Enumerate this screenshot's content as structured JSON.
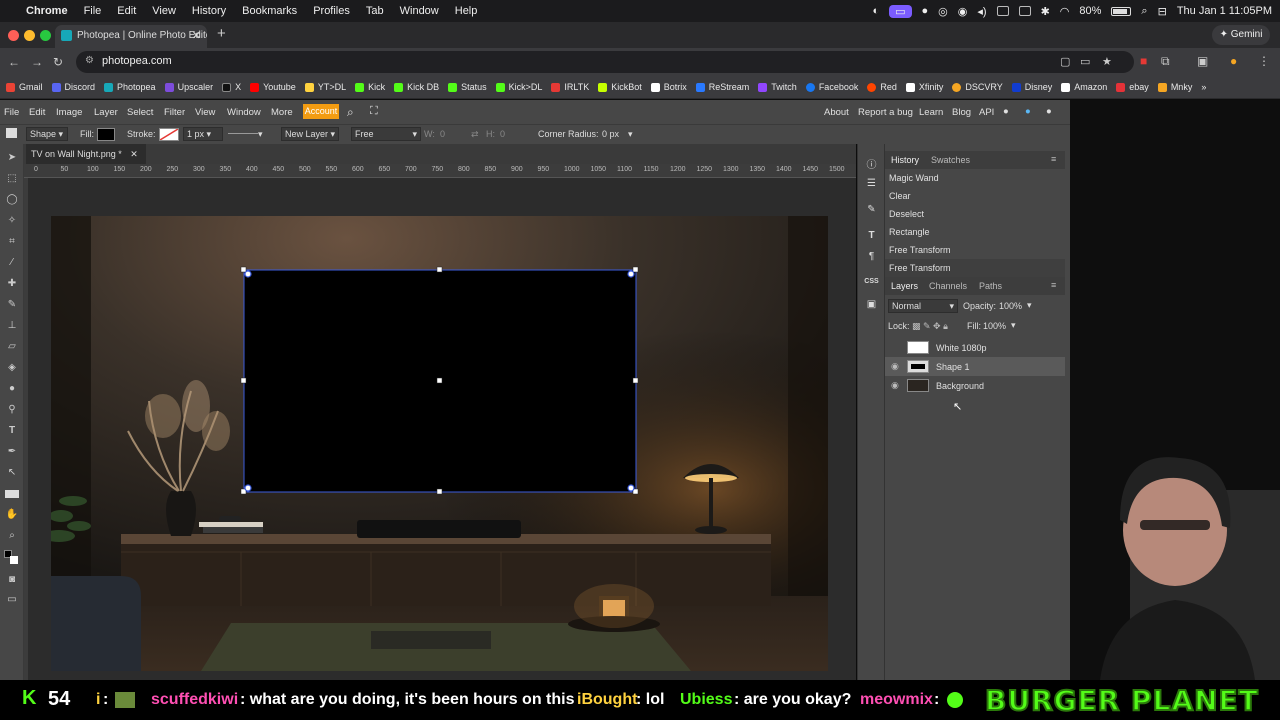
{
  "mac_menubar": {
    "app": "Chrome",
    "items": [
      "File",
      "Edit",
      "View",
      "History",
      "Bookmarks",
      "Profiles",
      "Tab",
      "Window",
      "Help"
    ],
    "battery": "80%",
    "datetime": "Thu Jan 1  11:05PM"
  },
  "browser": {
    "tab_title": "Photopea | Online Photo Edito",
    "url": "photopea.com",
    "gemini": "Gemini",
    "bookmarks": [
      {
        "label": "Gmail",
        "color": "#ea4335"
      },
      {
        "label": "Discord",
        "color": "#5865f2"
      },
      {
        "label": "Photopea",
        "color": "#17a8b8"
      },
      {
        "label": "Upscaler",
        "color": "#7d4cdb"
      },
      {
        "label": "X",
        "color": "#000000"
      },
      {
        "label": "Youtube",
        "color": "#ff0000"
      },
      {
        "label": "YT>DL",
        "color": "#ffd23f"
      },
      {
        "label": "Kick",
        "color": "#53fc18"
      },
      {
        "label": "Kick DB",
        "color": "#53fc18"
      },
      {
        "label": "Status",
        "color": "#53fc18"
      },
      {
        "label": "Kick>DL",
        "color": "#53fc18"
      },
      {
        "label": "IRLTK",
        "color": "#e53935"
      },
      {
        "label": "KickBot",
        "color": "#c6ff00"
      },
      {
        "label": "Botrix",
        "color": "#ffffff"
      },
      {
        "label": "ReStream",
        "color": "#2979ff"
      },
      {
        "label": "Twitch",
        "color": "#9146ff"
      },
      {
        "label": "Facebook",
        "color": "#1877f2"
      },
      {
        "label": "Red",
        "color": "#ff4500"
      },
      {
        "label": "Xfinity",
        "color": "#ffffff"
      },
      {
        "label": "DSCVRY",
        "color": "#f5a623"
      },
      {
        "label": "Disney",
        "color": "#113ccf"
      },
      {
        "label": "Amazon",
        "color": "#ffffff"
      },
      {
        "label": "ebay",
        "color": "#e53238"
      },
      {
        "label": "Mnky",
        "color": "#f5a623"
      }
    ]
  },
  "photopea": {
    "menu": [
      "File",
      "Edit",
      "Image",
      "Layer",
      "Select",
      "Filter",
      "View",
      "Window",
      "More"
    ],
    "account": "Account",
    "right_links": [
      "About",
      "Report a bug",
      "Learn",
      "Blog",
      "API"
    ],
    "options": {
      "shape": "Shape",
      "fill_label": "Fill:",
      "stroke_label": "Stroke:",
      "stroke_width": "1 px",
      "new_layer": "New Layer",
      "mode": "Free",
      "w_label": "W:",
      "w_value": "0",
      "h_label": "H:",
      "h_value": "0",
      "corner_label": "Corner Radius:",
      "corner_value": "0 px"
    },
    "doc_tab": "TV on Wall Night.png *",
    "ruler_marks": [
      "0",
      "50",
      "100",
      "150",
      "200",
      "250",
      "300",
      "350",
      "400",
      "450",
      "500",
      "550",
      "600",
      "650",
      "700",
      "750",
      "800",
      "850",
      "900",
      "950",
      "1000",
      "1050",
      "1100",
      "1150",
      "1200",
      "1250",
      "1300",
      "1350",
      "1400",
      "1450",
      "1500"
    ],
    "history": {
      "tabs": [
        "History",
        "Swatches"
      ],
      "items": [
        "Magic Wand",
        "Clear",
        "Deselect",
        "Rectangle",
        "Free Transform",
        "Free Transform"
      ]
    },
    "layers": {
      "tabs": [
        "Layers",
        "Channels",
        "Paths"
      ],
      "blend": "Normal",
      "opacity_label": "Opacity:",
      "opacity": "100%",
      "lock_label": "Lock:",
      "fill_label": "Fill:",
      "fill": "100%",
      "items": [
        "White 1080p",
        "Shape 1",
        "Background"
      ]
    }
  },
  "ticker": {
    "count": "54",
    "messages": [
      {
        "user": "i",
        "text": ":",
        "color": "#ffd23f"
      },
      {
        "user": "scuffedkiwi",
        "text": ": what are you doing, it's been hours on this",
        "color": "#ff4fb3"
      },
      {
        "user": "iBought",
        "text": ": lol",
        "color": "#ffd23f"
      },
      {
        "user": "Ubiess",
        "text": ": are you okay?",
        "color": "#53fc18"
      },
      {
        "user": "meowmix",
        "text": ":",
        "color": "#ff4fb3"
      }
    ],
    "banner": "BURGER PLANET"
  }
}
